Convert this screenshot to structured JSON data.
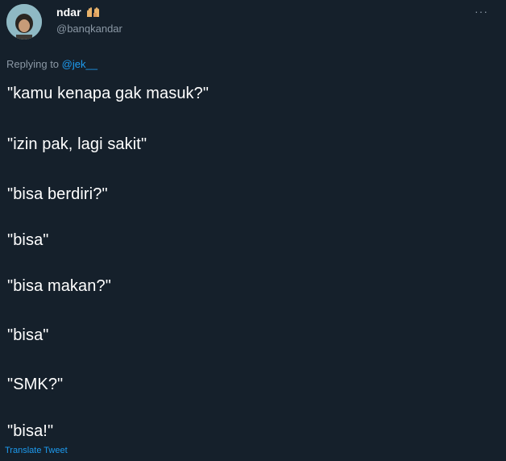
{
  "author": {
    "display_name": "ndar",
    "emoji": "hands-icon",
    "handle": "@banqkandar"
  },
  "menu": {
    "more_label": "···"
  },
  "reply": {
    "prefix": "Replying to",
    "mention": "@jek__"
  },
  "tweet": {
    "lines": [
      "\"kamu kenapa gak masuk?\"",
      "\"izin pak, lagi sakit\"",
      "\"bisa berdiri?\"",
      "\"bisa\"",
      "\"bisa makan?\"",
      "\"bisa\"",
      "\"SMK?\"",
      "\"bisa!\""
    ]
  },
  "actions": {
    "translate_label": "Translate Tweet"
  },
  "colors": {
    "background": "#15202b",
    "text": "#ffffff",
    "secondary": "#8b98a5",
    "accent": "#1d9bf0"
  }
}
